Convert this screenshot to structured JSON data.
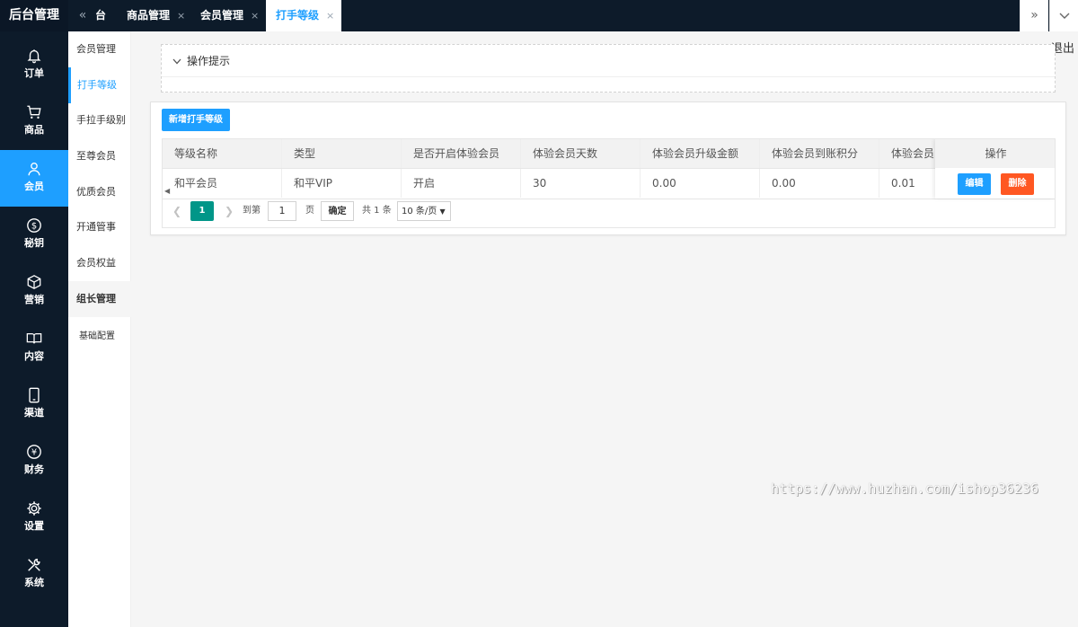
{
  "brand": "后台管理",
  "tabs": [
    {
      "label": "台",
      "closable": false
    },
    {
      "label": "商品管理",
      "closable": true
    },
    {
      "label": "会员管理",
      "closable": true
    },
    {
      "label": "打手等级",
      "closable": true
    }
  ],
  "tab_close_glyph": "×",
  "logout": "退出",
  "sidebar": [
    {
      "label": "订单",
      "icon": "bell-icon"
    },
    {
      "label": "商品",
      "icon": "cart-icon"
    },
    {
      "label": "会员",
      "icon": "user-icon"
    },
    {
      "label": "秘钥",
      "icon": "dollar-icon"
    },
    {
      "label": "营销",
      "icon": "box-icon"
    },
    {
      "label": "内容",
      "icon": "book-icon"
    },
    {
      "label": "渠道",
      "icon": "phone-icon"
    },
    {
      "label": "财务",
      "icon": "yen-icon"
    },
    {
      "label": "设置",
      "icon": "gear-icon"
    },
    {
      "label": "系统",
      "icon": "tools-icon"
    }
  ],
  "submenu": [
    {
      "label": "会员管理"
    },
    {
      "label": "打手等级"
    },
    {
      "label": "手拉手级别"
    },
    {
      "label": "至尊会员"
    },
    {
      "label": "优质会员"
    },
    {
      "label": "开通管事"
    },
    {
      "label": "会员权益"
    },
    {
      "label": "组长管理"
    },
    {
      "label": "基础配置"
    }
  ],
  "tips": {
    "title": "操作提示"
  },
  "add_button": "新增打手等级",
  "table": {
    "columns": [
      "等级名称",
      "类型",
      "是否开启体验会员",
      "体验会员天数",
      "体验会员升级金额",
      "体验会员到账积分",
      "体验会员"
    ],
    "action_header": "操作",
    "rows": [
      [
        "和平会员",
        "和平VIP",
        "开启",
        "30",
        "0.00",
        "0.00",
        "0.01"
      ]
    ],
    "edit_label": "编辑",
    "delete_label": "删除"
  },
  "pager": {
    "current": "1",
    "goto_label": "到第",
    "goto_value": "1",
    "page_unit": "页",
    "confirm": "确定",
    "total": "共 1 条",
    "page_size": "10 条/页"
  },
  "watermark": "https://www.huzhan.com/ishop36236",
  "colors": {
    "primary": "#1e9fff",
    "danger": "#ff5722",
    "pager_active": "#009688",
    "sidebar_bg": "#0d1b2a"
  }
}
